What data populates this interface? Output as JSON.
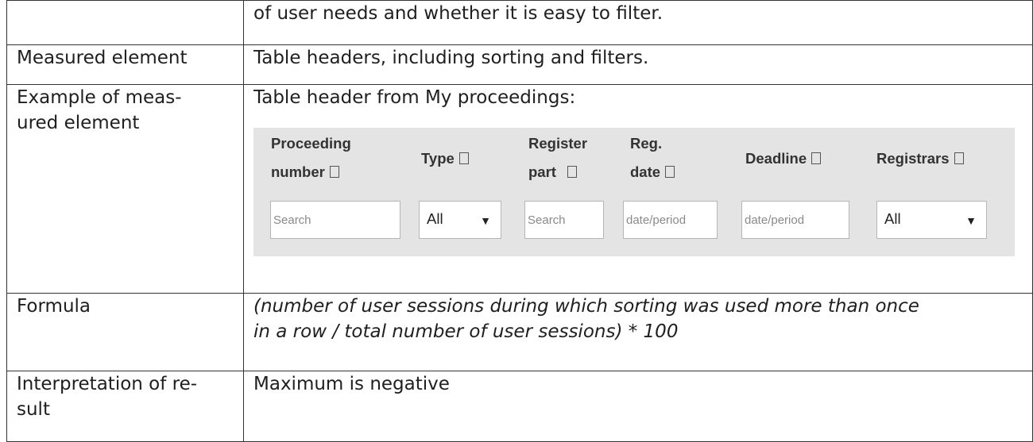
{
  "rows": [
    {
      "label": "",
      "value": "of user needs and whether it is easy to filter."
    },
    {
      "label": "Measured element",
      "value": "Table headers, including sorting and filters."
    },
    {
      "label_line1": "Example of meas-",
      "label_line2": "ured element",
      "value": "Table header from My proceedings:"
    },
    {
      "label": "Formula",
      "value_line1": "(number of user sessions during which sorting was used more than once",
      "value_line2": "in a row / total number of user sessions) * 100"
    },
    {
      "label_line1": "Interpretation of re-",
      "label_line2": "sult",
      "value": "Maximum is negative"
    }
  ],
  "example_header": {
    "background": "#e4e4e4",
    "columns": [
      {
        "line1": "Proceeding",
        "line2": "number",
        "filter_type": "input",
        "placeholder": "Search"
      },
      {
        "line1": "",
        "line2": "Type",
        "filter_type": "select",
        "selected": "All"
      },
      {
        "line1": "Register",
        "line2": "part",
        "filter_type": "input",
        "placeholder": "Search"
      },
      {
        "line1": "Reg.",
        "line2": "date",
        "filter_type": "input",
        "placeholder": "date/period"
      },
      {
        "line1": "",
        "line2": "Deadline",
        "filter_type": "input",
        "placeholder": "date/period"
      },
      {
        "line1": "",
        "line2": "Registrars",
        "filter_type": "select",
        "selected": "All"
      }
    ]
  }
}
